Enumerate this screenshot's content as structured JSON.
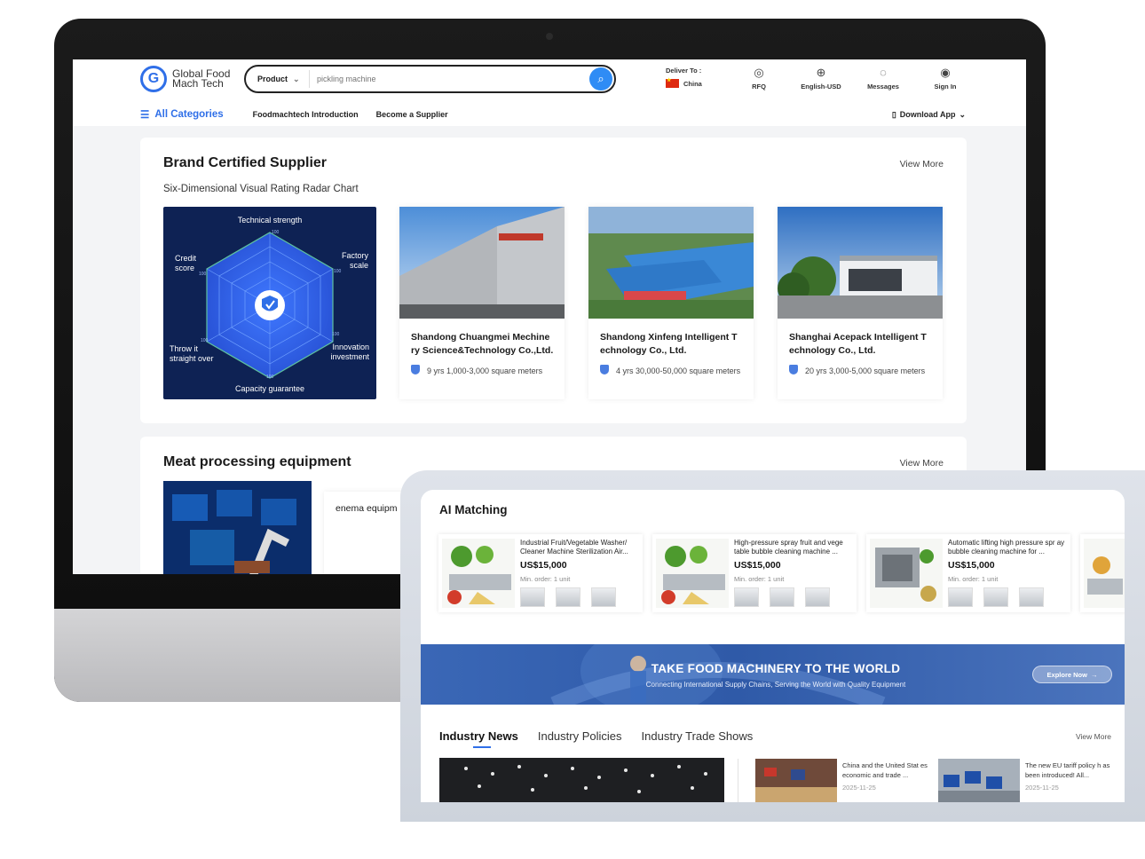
{
  "header": {
    "logo_line1": "Global Food",
    "logo_line2": "Mach Tech",
    "search_category": "Product",
    "search_placeholder": "pickling machine",
    "deliver_label": "Deliver To :",
    "deliver_country": "China",
    "tools": [
      {
        "label": "RFQ",
        "icon": "rfq-icon"
      },
      {
        "label": "English-USD",
        "icon": "globe-icon"
      },
      {
        "label": "Messages",
        "icon": "messages-icon"
      },
      {
        "label": "Sign In",
        "icon": "user-icon"
      }
    ]
  },
  "nav": {
    "all_categories": "All Categories",
    "links": [
      "Foodmachtech Introduction",
      "Become a Supplier"
    ],
    "download_app": "Download App"
  },
  "brand_section": {
    "title": "Brand Certified Supplier",
    "view_more": "View More",
    "subtitle": "Six-Dimensional Visual Rating Radar Chart",
    "radar": {
      "labels": [
        "Technical strength",
        "Factory scale",
        "Innovation investment",
        "Capacity guarantee",
        "Throw it straight over",
        "Credit score"
      ],
      "values": [
        100,
        100,
        100,
        100,
        100,
        100
      ]
    },
    "suppliers": [
      {
        "name": "Shandong Chuangmei Mechine ry Science&Technology Co.,Ltd.",
        "meta": "9 yrs 1,000-3,000 square meters"
      },
      {
        "name": "Shandong Xinfeng Intelligent T echnology Co., Ltd.",
        "meta": "4 yrs 30,000-50,000 square meters"
      },
      {
        "name": "Shanghai Acepack Intelligent T echnology Co., Ltd.",
        "meta": "20 yrs 3,000-5,000 square meters"
      }
    ]
  },
  "meat_section": {
    "title": "Meat processing equipment",
    "view_more": "View More",
    "product_name": "enema equipm"
  },
  "ai_matching": {
    "title": "AI Matching",
    "products": [
      {
        "name": "Industrial Fruit/Vegetable Washer/ Cleaner Machine Sterilization Air...",
        "price": "US$15,000",
        "min_order": "Min. order: 1 unit"
      },
      {
        "name": "High-pressure spray fruit and vege table bubble cleaning machine ...",
        "price": "US$15,000",
        "min_order": "Min. order: 1 unit"
      },
      {
        "name": "Automatic lifting high pressure spr ay bubble cleaning machine for ...",
        "price": "US$15,000",
        "min_order": "Min. order: 1 unit"
      }
    ]
  },
  "banner": {
    "title": "TAKE FOOD MACHINERY TO THE WORLD",
    "subtitle": "Connecting International Supply Chains, Serving the World with Quality Equipment",
    "button": "Explore Now"
  },
  "news": {
    "tabs": [
      "Industry News",
      "Industry Policies",
      "Industry Trade Shows"
    ],
    "view_more": "View More",
    "items": [
      {
        "title": "China and the United Stat es economic and trade ...",
        "date": "2025-11-25"
      },
      {
        "title": "The new EU tariff policy h as been introduced! All...",
        "date": "2025-11-25"
      }
    ]
  },
  "colors": {
    "brand_blue": "#2f6fe8",
    "radar_bg": "#0e2254",
    "banner_blue": "#3a67b6"
  }
}
